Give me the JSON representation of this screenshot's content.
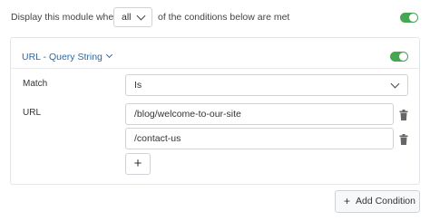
{
  "header": {
    "prefix_text": "Display this module when",
    "match_mode": "all",
    "suffix_text": "of the conditions below are met",
    "enabled": true
  },
  "condition": {
    "type_label": "URL - Query String",
    "enabled": true,
    "match_label": "Match",
    "match_value": "Is",
    "url_label": "URL",
    "url_values": [
      "/blog/welcome-to-our-site",
      "/contact-us"
    ],
    "add_value_label": "+"
  },
  "footer": {
    "add_condition_label": "Add Condition",
    "add_condition_icon": "plus-icon"
  },
  "colors": {
    "toggle_on": "#46a651",
    "link": "#2b6aa8"
  }
}
